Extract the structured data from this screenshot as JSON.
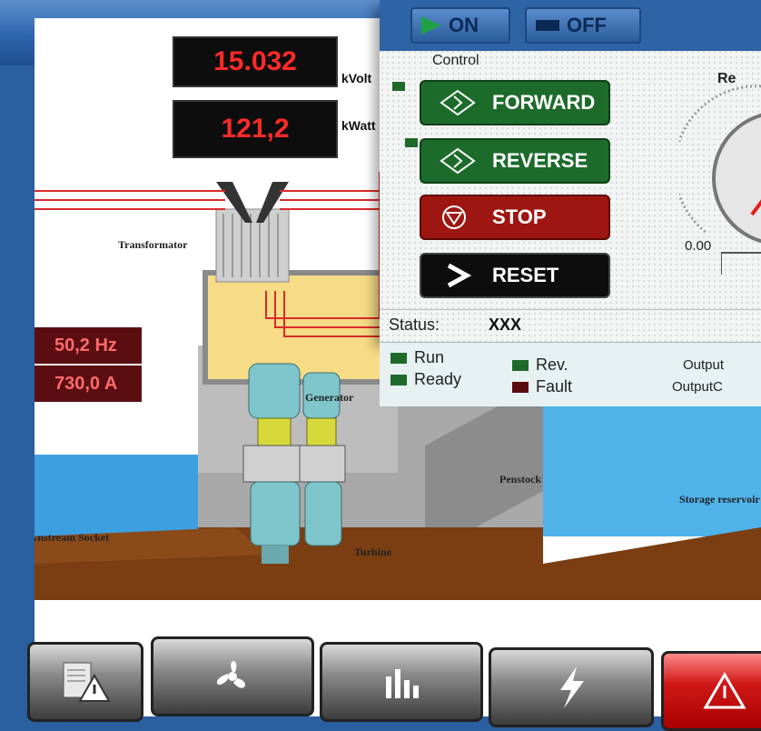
{
  "top_bar": {
    "on_label": "ON",
    "off_label": "OFF"
  },
  "displays": {
    "voltage": {
      "value": "15.032",
      "unit": "kVolt"
    },
    "power": {
      "value": "121,2",
      "unit": "kWatt"
    },
    "frequency": {
      "value": "50,2 Hz"
    },
    "current": {
      "value": "730,0 A"
    }
  },
  "labels": {
    "transformator": "Transformator",
    "generator": "Generator",
    "penstock": "Penstock",
    "turbine": "Turbine",
    "downstream": "Downstream Socket",
    "storage": "Storage reservoir"
  },
  "control_panel": {
    "section_label": "Control",
    "buttons": {
      "forward": "FORWARD",
      "reverse": "REVERSE",
      "stop": "STOP",
      "reset": "RESET"
    },
    "gauge": {
      "title": "Re",
      "min_label": "0.00"
    },
    "status_label": "Status:",
    "status_value": "XXX",
    "indicators": {
      "run": "Run",
      "ready": "Ready",
      "rev": "Rev.",
      "fault": "Fault"
    },
    "output_1": "Output",
    "output_2": "OutputC"
  },
  "colors": {
    "header_blue": "#2d65ad",
    "display_red": "#ff2a2a",
    "button_green": "#1d6b2b",
    "button_red": "#9e1612",
    "water_blue": "#3ca0e0",
    "earth_brown": "#7a3e12"
  },
  "toolbar": {
    "items": [
      {
        "icon": "document-warning-icon"
      },
      {
        "icon": "fan-icon"
      },
      {
        "icon": "bar-chart-icon"
      },
      {
        "icon": "lightning-icon"
      },
      {
        "icon": "alarm-warning-icon"
      }
    ]
  }
}
